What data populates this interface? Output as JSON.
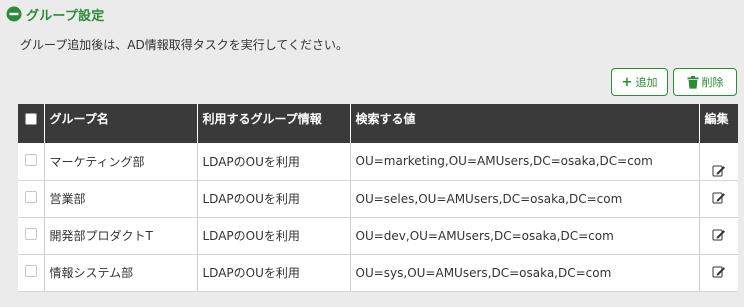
{
  "section": {
    "title": "グループ設定"
  },
  "description": "グループ追加後は、AD情報取得タスクを実行してください。",
  "toolbar": {
    "add_label": "追加",
    "delete_label": "削除"
  },
  "table": {
    "columns": [
      "グループ名",
      "利用するグループ情報",
      "検索する値",
      "編集"
    ],
    "rows": [
      {
        "name": "マーケティング部",
        "source": "LDAPのOUを利用",
        "value": "OU=marketing,OU=AMUsers,DC=osaka,DC=com"
      },
      {
        "name": "営業部",
        "source": "LDAPのOUを利用",
        "value": "OU=seles,OU=AMUsers,DC=osaka,DC=com"
      },
      {
        "name": "開発部プロダクトT",
        "source": "LDAPのOUを利用",
        "value": "OU=dev,OU=AMUsers,DC=osaka,DC=com"
      },
      {
        "name": "情報システム部",
        "source": "LDAPのOUを利用",
        "value": "OU=sys,OU=AMUsers,DC=osaka,DC=com"
      }
    ]
  },
  "icons": {
    "collapse": "minus-circle-icon",
    "add": "plus-icon",
    "delete": "trash-icon",
    "edit": "pencil-icon"
  },
  "colors": {
    "accent": "#2f8a3a",
    "header_bg": "#3a3a3a",
    "page_bg": "#ebebeb"
  }
}
